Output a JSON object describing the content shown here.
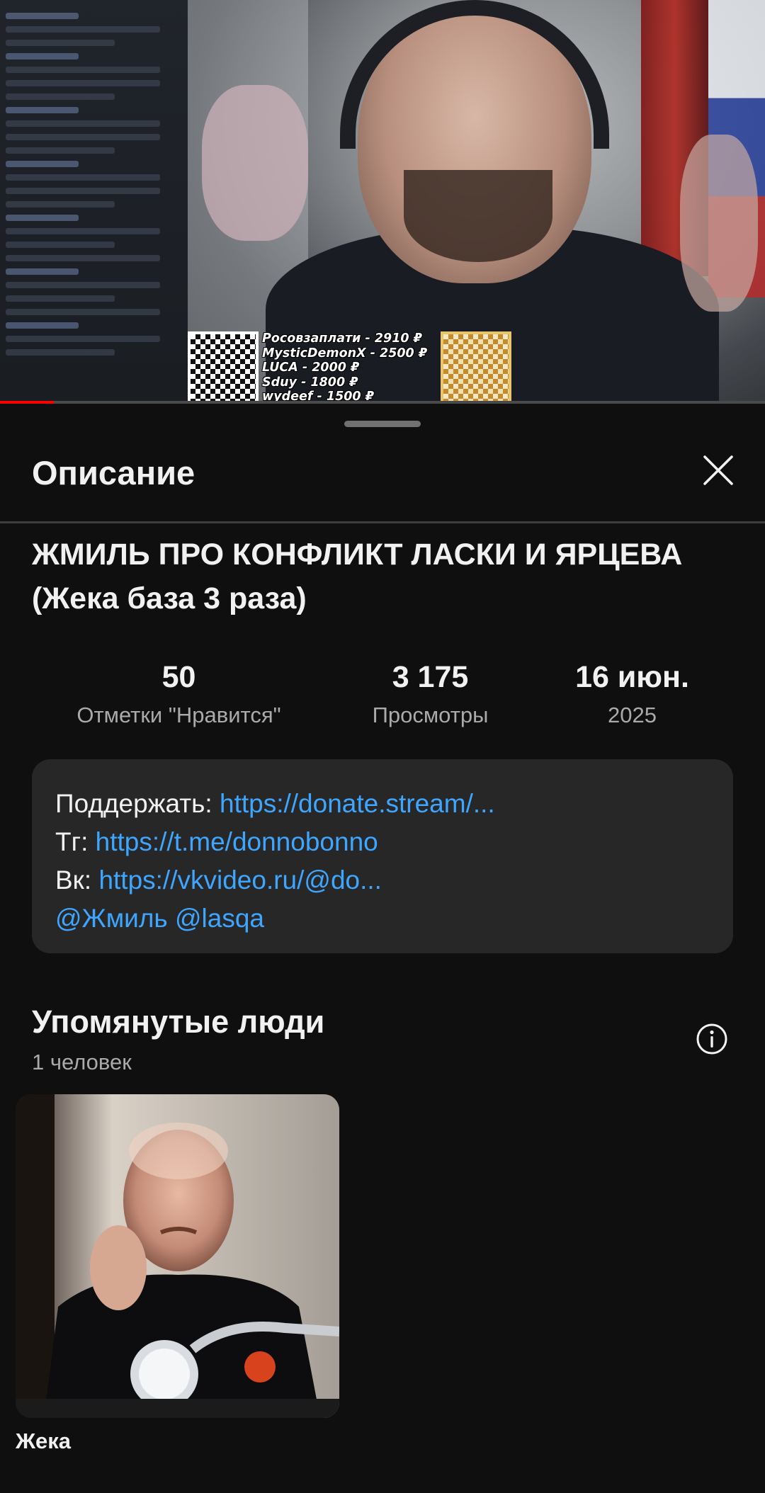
{
  "video": {
    "donations": [
      "Росовзаплати - 2910 ₽",
      "MysticDemonX - 2500 ₽",
      "LUCA - 2000 ₽",
      "Sduy - 1800 ₽",
      "wydeef - 1500 ₽"
    ],
    "progress_fraction": 0.07
  },
  "sheet": {
    "title": "Описание",
    "close_icon": "close-icon"
  },
  "video_title": "ЖМИЛЬ ПРО КОНФЛИКТ ЛАСКИ И ЯРЦЕВА (Жека база 3 раза)",
  "stats": {
    "likes": {
      "value": "50",
      "label": "Отметки \"Нравится\""
    },
    "views": {
      "value": "3 175",
      "label": "Просмотры"
    },
    "date": {
      "value": "16 июн.",
      "label": "2025"
    }
  },
  "description": {
    "support_label": "Поддержать: ",
    "support_link": "https://donate.stream/...",
    "tg_label": "Тг: ",
    "tg_link": "https://t.me/donnobonno",
    "vk_label": "Вк: ",
    "vk_link": "https://vkvideo.ru/@do...",
    "mention_1": "@Жмиль",
    "mention_2": "@lasqa"
  },
  "people": {
    "title": "Упомянутые люди",
    "count": "1 человек",
    "info_icon": "info-icon",
    "items": [
      {
        "name": "Жека"
      }
    ]
  },
  "colors": {
    "background": "#0f0f0f",
    "card": "#272727",
    "link": "#3ea6ff",
    "secondary_text": "#aaaaaa",
    "progress": "#ff0000"
  }
}
